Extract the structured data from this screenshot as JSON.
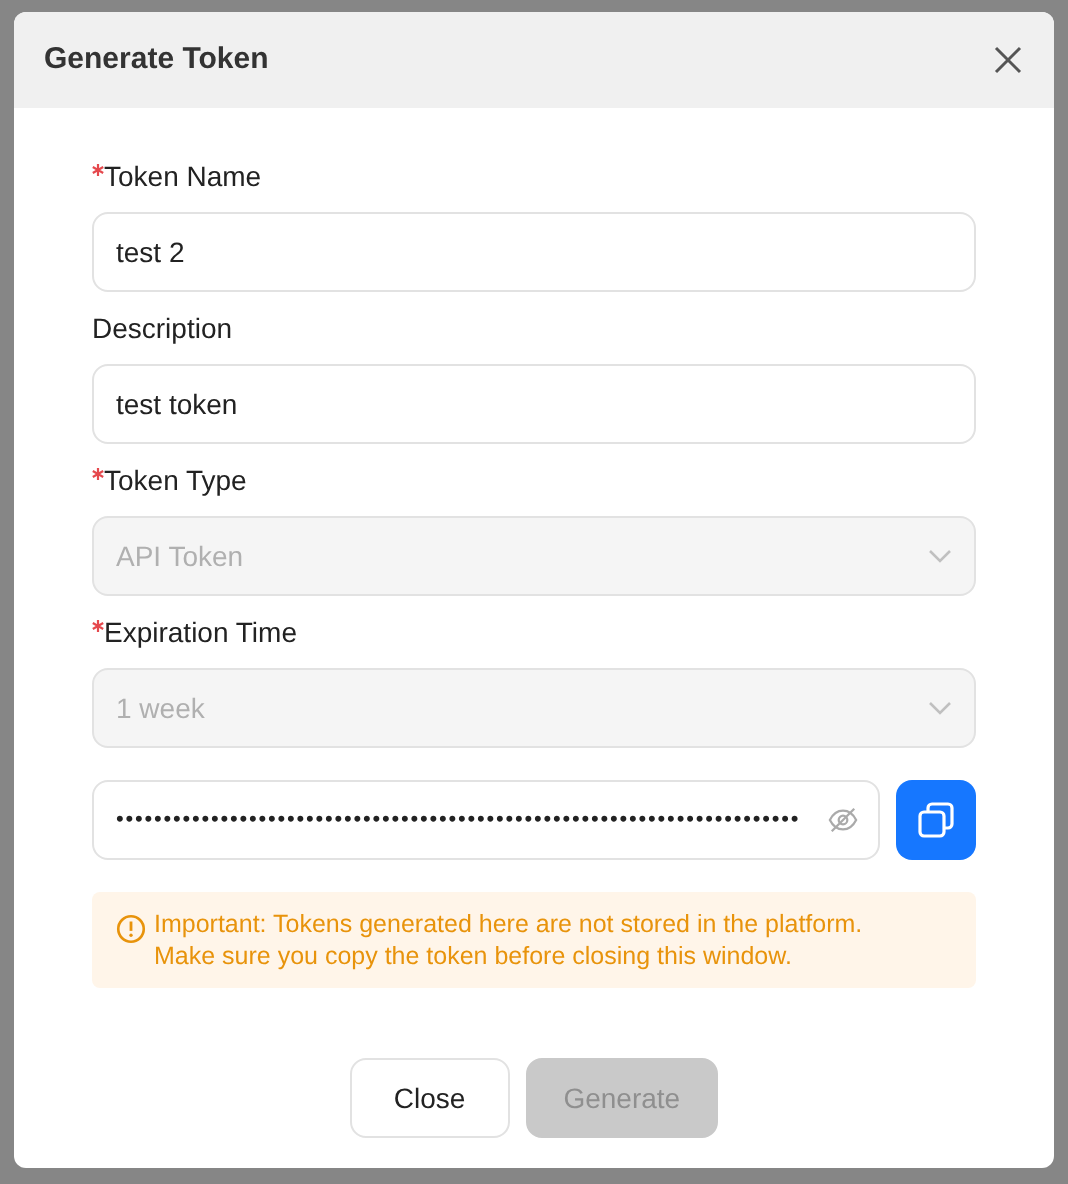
{
  "dialog": {
    "title": "Generate Token",
    "fields": [
      {
        "kind": "input",
        "label": "Token Name",
        "required": true,
        "value": "test 2",
        "disabled": false
      },
      {
        "kind": "input",
        "label": "Description",
        "required": false,
        "value": "test token",
        "disabled": false
      },
      {
        "kind": "select",
        "label": "Token Type",
        "required": true,
        "value": "API Token",
        "disabled": true
      },
      {
        "kind": "select",
        "label": "Expiration Time",
        "required": true,
        "value": "1 week",
        "disabled": true
      }
    ],
    "token": {
      "masked_value": "••••••••••••••••••••••••••••••••••••••••••••••••••••••••••••••••••••••••"
    },
    "alert": {
      "lines": [
        "Important: Tokens generated here are not stored in the platform.",
        "Make sure you copy the token before closing this window."
      ]
    },
    "buttons": [
      {
        "label": "Close",
        "kind": "default",
        "disabled": false
      },
      {
        "label": "Generate",
        "kind": "primary",
        "disabled": true
      }
    ]
  }
}
